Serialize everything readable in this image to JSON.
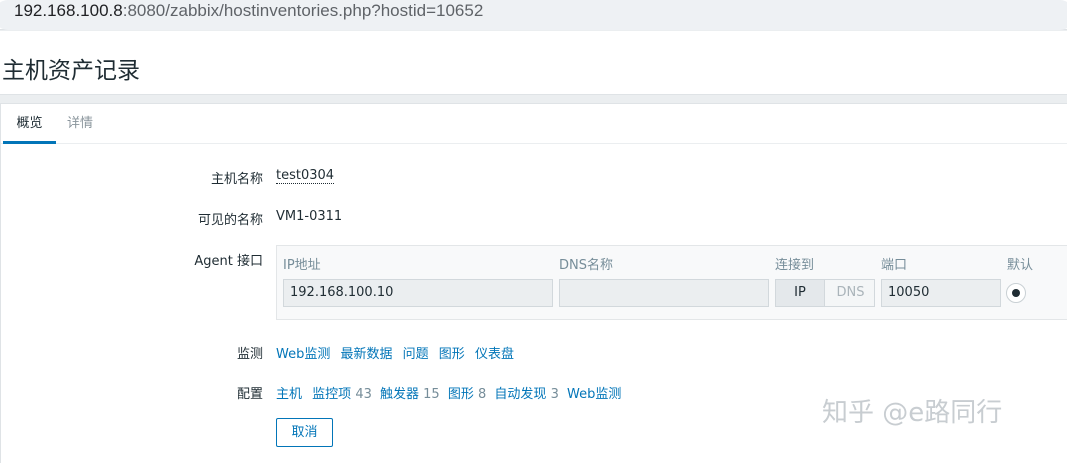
{
  "browser": {
    "url_host": "192.168.100.8",
    "url_rest": ":8080/zabbix/hostinventories.php?hostid=10652"
  },
  "page": {
    "title": "主机资产记录"
  },
  "tabs": [
    {
      "label": "概览",
      "active": true
    },
    {
      "label": "详情",
      "active": false
    }
  ],
  "fields": {
    "host_name_label": "主机名称",
    "host_name_value": "test0304",
    "visible_name_label": "可见的名称",
    "visible_name_value": "VM1-0311",
    "agent_label": "Agent 接口"
  },
  "interface": {
    "headers": {
      "ip": "IP地址",
      "dns": "DNS名称",
      "connect_to": "连接到",
      "port": "端口",
      "default": "默认"
    },
    "ip_value": "192.168.100.10",
    "dns_value": "",
    "connect_options": [
      "IP",
      "DNS"
    ],
    "port_value": "10050"
  },
  "monitoring": {
    "label": "监测",
    "links": [
      "Web监测",
      "最新数据",
      "问题",
      "图形",
      "仪表盘"
    ]
  },
  "configuration": {
    "label": "配置",
    "host_link": "主机",
    "items_link": "监控项",
    "items_count": "43",
    "triggers_link": "触发器",
    "triggers_count": "15",
    "graphs_link": "图形",
    "graphs_count": "8",
    "discovery_link": "自动发现",
    "discovery_count": "3",
    "web_link": "Web监测"
  },
  "buttons": {
    "cancel": "取消"
  },
  "watermark": "知乎 @e路同行",
  "colors": {
    "link": "#0275b8",
    "text": "#1f2c33",
    "muted": "#768d99"
  }
}
